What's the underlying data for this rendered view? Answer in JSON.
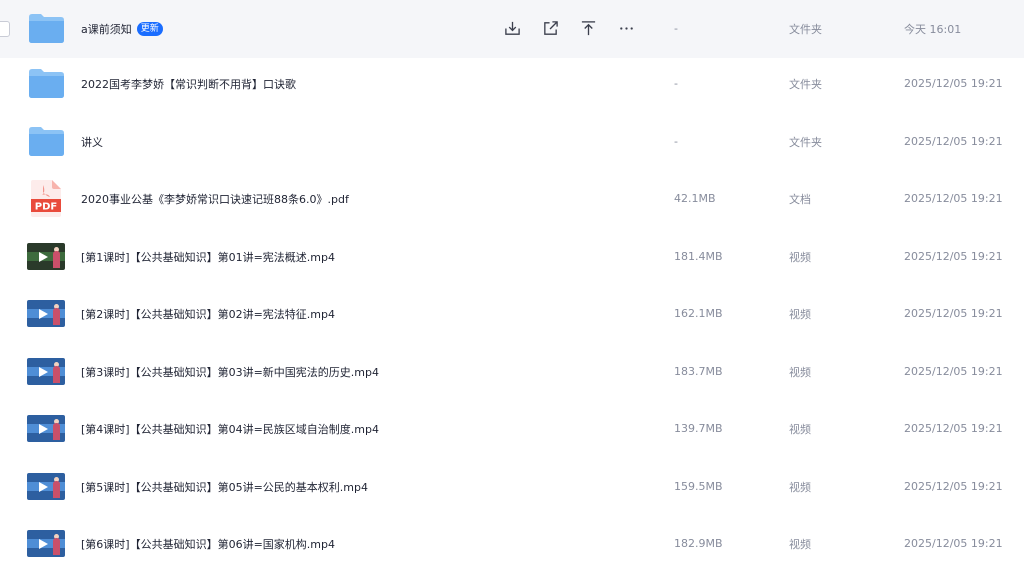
{
  "actions": {
    "download_icon": "download-icon",
    "share_icon": "share-icon",
    "move_top_icon": "move-to-top-icon",
    "more_icon": "more-icon"
  },
  "colors": {
    "badge_bg": "#1a6dff",
    "hover_row": "#f5f6f9",
    "folder": "#6aaef0",
    "pdf_red": "#e94b3c"
  },
  "files": [
    {
      "name": "a课前须知",
      "badge": "更新",
      "size": "-",
      "type": "文件夹",
      "time": "今天 16:01",
      "icon": "folder-icon"
    },
    {
      "name": "2022国考李梦娇【常识判断不用背】口诀歌",
      "badge": "",
      "size": "-",
      "type": "文件夹",
      "time": "2025/12/05 19:21",
      "icon": "folder-icon"
    },
    {
      "name": "讲义",
      "badge": "",
      "size": "-",
      "type": "文件夹",
      "time": "2025/12/05 19:21",
      "icon": "folder-icon"
    },
    {
      "name": "2020事业公基《李梦娇常识口诀速记班88条6.0》.pdf",
      "badge": "",
      "size": "42.1MB",
      "type": "文档",
      "time": "2025/12/05 19:21",
      "icon": "pdf-icon",
      "pdf_label": "PDF"
    },
    {
      "name": "[第1课时]【公共基础知识】第01讲=宪法概述.mp4",
      "badge": "",
      "size": "181.4MB",
      "type": "视频",
      "time": "2025/12/05 19:21",
      "icon": "video-thumbnail-icon"
    },
    {
      "name": "[第2课时]【公共基础知识】第02讲=宪法特征.mp4",
      "badge": "",
      "size": "162.1MB",
      "type": "视频",
      "time": "2025/12/05 19:21",
      "icon": "video-thumbnail-icon"
    },
    {
      "name": "[第3课时]【公共基础知识】第03讲=新中国宪法的历史.mp4",
      "badge": "",
      "size": "183.7MB",
      "type": "视频",
      "time": "2025/12/05 19:21",
      "icon": "video-thumbnail-icon"
    },
    {
      "name": "[第4课时]【公共基础知识】第04讲=民族区域自治制度.mp4",
      "badge": "",
      "size": "139.7MB",
      "type": "视频",
      "time": "2025/12/05 19:21",
      "icon": "video-thumbnail-icon"
    },
    {
      "name": "[第5课时]【公共基础知识】第05讲=公民的基本权利.mp4",
      "badge": "",
      "size": "159.5MB",
      "type": "视频",
      "time": "2025/12/05 19:21",
      "icon": "video-thumbnail-icon"
    },
    {
      "name": "[第6课时]【公共基础知识】第06讲=国家机构.mp4",
      "badge": "",
      "size": "182.9MB",
      "type": "视频",
      "time": "2025/12/05 19:21",
      "icon": "video-thumbnail-icon"
    }
  ]
}
